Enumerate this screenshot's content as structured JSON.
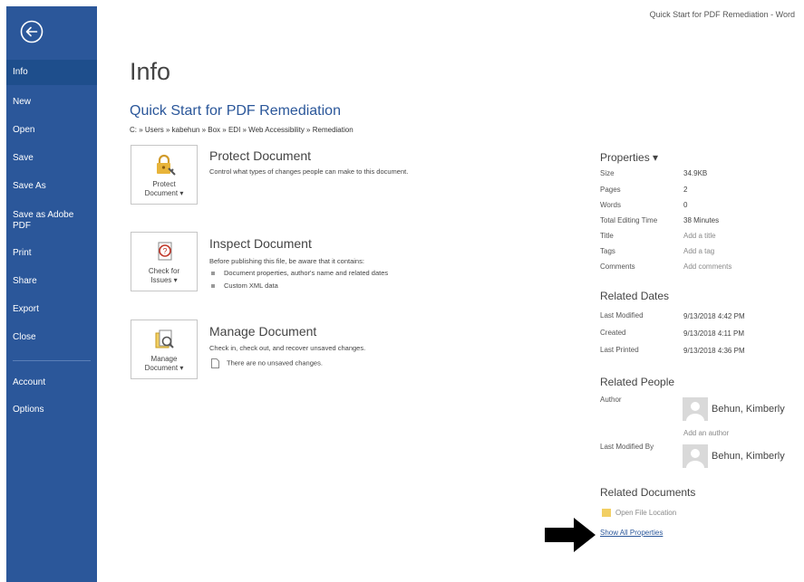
{
  "window": {
    "title": "Quick Start for PDF Remediation - Word"
  },
  "colors": {
    "sidebar": "#2b579a",
    "sidebar_active": "#1e4e8c",
    "link": "#2b579a"
  },
  "sidebar": {
    "items": [
      {
        "label": "Info",
        "active": true
      },
      {
        "label": "New"
      },
      {
        "label": "Open"
      },
      {
        "label": "Save"
      },
      {
        "label": "Save As"
      },
      {
        "label": "Save as Adobe PDF"
      },
      {
        "label": "Print"
      },
      {
        "label": "Share"
      },
      {
        "label": "Export"
      },
      {
        "label": "Close"
      },
      {
        "label": "Account"
      },
      {
        "label": "Options"
      }
    ]
  },
  "main": {
    "heading": "Info",
    "document_title": "Quick Start for PDF Remediation",
    "document_path": "C: » Users » kabehun » Box » EDI » Web Accessibility » Remediation",
    "sections": [
      {
        "button_label_1": "Protect",
        "button_label_2": "Document ▾",
        "icon": "lock-icon",
        "title": "Protect Document",
        "description": "Control what types of changes people can make to this document."
      },
      {
        "button_label_1": "Check for",
        "button_label_2": "Issues ▾",
        "icon": "inspect-icon",
        "title": "Inspect Document",
        "description": "Before publishing this file, be aware that it contains:",
        "bullets": [
          "Document properties, author's name and related dates",
          "Custom XML data"
        ]
      },
      {
        "button_label_1": "Manage",
        "button_label_2": "Document ▾",
        "icon": "manage-document-icon",
        "title": "Manage Document",
        "description": "Check in, check out, and recover unsaved changes.",
        "note": "There are no unsaved changes."
      }
    ]
  },
  "properties": {
    "heading": "Properties ▾",
    "rows": [
      {
        "label": "Size",
        "value": "34.9KB"
      },
      {
        "label": "Pages",
        "value": "2"
      },
      {
        "label": "Words",
        "value": "0"
      },
      {
        "label": "Total Editing Time",
        "value": "38 Minutes"
      },
      {
        "label": "Title",
        "value": "Add a title",
        "placeholder": true
      },
      {
        "label": "Tags",
        "value": "Add a tag",
        "placeholder": true
      },
      {
        "label": "Comments",
        "value": "Add comments",
        "placeholder": true
      }
    ]
  },
  "related_dates": {
    "heading": "Related Dates",
    "rows": [
      {
        "label": "Last Modified",
        "value": "9/13/2018 4:42 PM"
      },
      {
        "label": "Created",
        "value": "9/13/2018 4:11 PM"
      },
      {
        "label": "Last Printed",
        "value": "9/13/2018 4:36 PM"
      }
    ]
  },
  "related_people": {
    "heading": "Related People",
    "author_label": "Author",
    "author_name": "Behun, Kimberly",
    "add_author": "Add an author",
    "last_modified_by_label": "Last Modified By",
    "last_modified_by_name": "Behun, Kimberly"
  },
  "related_documents": {
    "heading": "Related Documents",
    "open_file_location": "Open File Location",
    "show_all_properties": "Show All Properties"
  }
}
